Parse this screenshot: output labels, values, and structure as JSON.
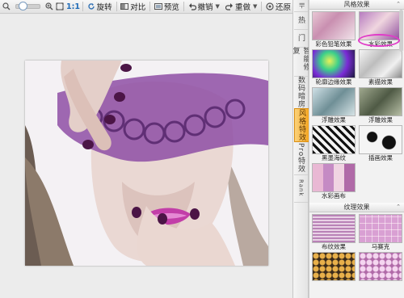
{
  "toolbar": {
    "zoom_ratio": "1:1",
    "zoom_level": 0.1,
    "rotate": "旋转",
    "compare": "对比",
    "preview": "预览",
    "undo": "撤销",
    "redo": "重做",
    "restore": "还原"
  },
  "side_tabs": [
    {
      "label": "热"
    },
    {
      "label": "门"
    },
    {
      "label": "智能修复"
    },
    {
      "label": "数码暗房"
    },
    {
      "label": "风格特效"
    },
    {
      "label": "Pro特效"
    },
    {
      "label": "Rank"
    }
  ],
  "panel": {
    "style_section": {
      "title": "风格效果",
      "items": [
        {
          "label": "彩色铅笔效果"
        },
        {
          "label": "水彩效果"
        },
        {
          "label": "轮廓边缘效果"
        },
        {
          "label": "素描效果"
        },
        {
          "label": "浮雕效果"
        },
        {
          "label": "浮雕效果"
        },
        {
          "label": "黑墨海纹"
        },
        {
          "label": "插画效果"
        },
        {
          "label": "水彩画布"
        }
      ]
    },
    "texture_section": {
      "title": "纹理效果",
      "items": [
        {
          "label": "布纹效果"
        },
        {
          "label": "马赛克"
        }
      ]
    }
  },
  "colors": {
    "highlight_ellipse": "#e03cc8",
    "active_tab": "#f4a623",
    "zoom_ratio": "#1f6bb8"
  }
}
